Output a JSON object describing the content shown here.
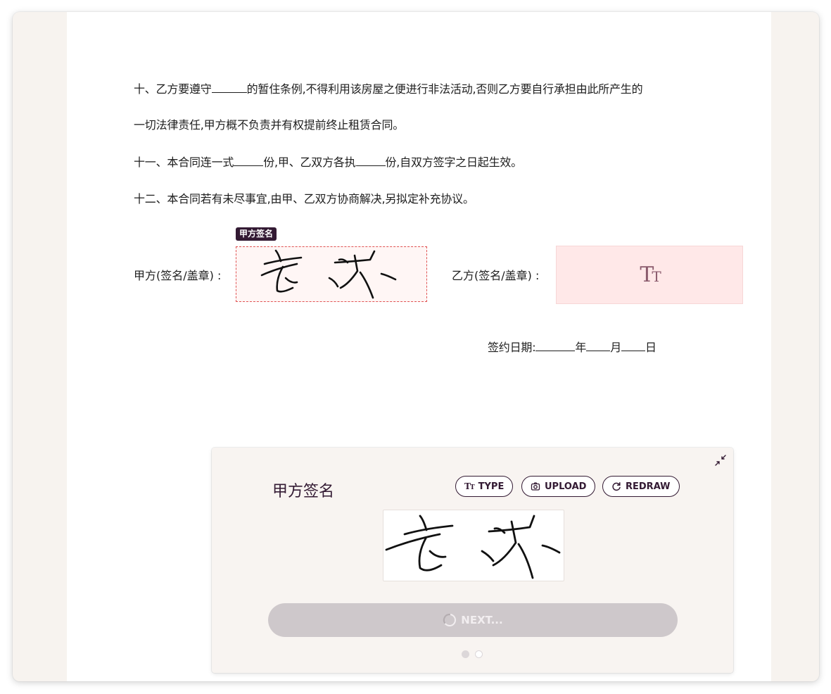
{
  "document": {
    "clause10_a": "十、乙方要遵守",
    "clause10_b": "的暂住条例,不得利用该房屋之便进行非法活动,否则乙方要自行承担由此所产生的",
    "clause10_c": "一切法律责任,甲方概不负责并有权提前终止租赁合同。",
    "clause11_a": "十一、本合同连一式",
    "clause11_b": "份,甲、乙双方各执",
    "clause11_c": "份,自双方签字之日起生效。",
    "clause12": "十二、本合同若有未尽事宜,由甲、乙双方协商解决,另拟定补充协议。",
    "party_a_label": "甲方(签名/盖章) :",
    "party_b_label": "乙方(签名/盖章) :",
    "party_a_tag": "甲方签名",
    "date_label": "签约日期:",
    "date_year": "年",
    "date_month": "月",
    "date_day": "日"
  },
  "signature_panel": {
    "title": "甲方签名",
    "type_label": "TYPE",
    "upload_label": "UPLOAD",
    "redraw_label": "REDRAW",
    "next_label": "NEXT...",
    "step_current": 1,
    "step_total": 2
  },
  "colors": {
    "brand_dark": "#331a33",
    "field_border": "#e05353",
    "field_bg": "#ffe8e8",
    "next_disabled": "#cec8cb"
  },
  "icons": [
    "text-type-icon",
    "camera-icon",
    "redraw-icon",
    "collapse-icon",
    "spinner-icon"
  ]
}
